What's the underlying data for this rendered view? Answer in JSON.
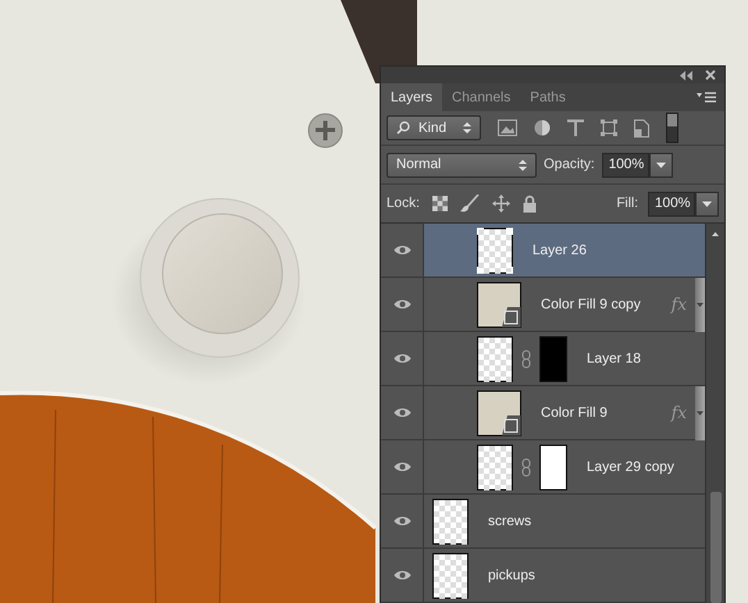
{
  "panel": {
    "tabs": [
      {
        "label": "Layers",
        "selected": true
      },
      {
        "label": "Channels",
        "selected": false
      },
      {
        "label": "Paths",
        "selected": false
      }
    ],
    "filter": {
      "value": "Kind"
    },
    "blend_mode": {
      "value": "Normal"
    },
    "opacity": {
      "label": "Opacity:",
      "value": "100%"
    },
    "lock": {
      "label": "Lock:"
    },
    "fill": {
      "label": "Fill:",
      "value": "100%"
    },
    "layers": [
      {
        "children": [
          {
            "name": "Layer 26",
            "kind": "plain",
            "visible": true,
            "selected": true
          },
          {
            "name": "Color Fill 9 copy",
            "kind": "fill",
            "visible": true,
            "selected": false,
            "effects": "fx"
          },
          {
            "name": "Layer 18",
            "kind": "masked",
            "visible": true,
            "selected": false,
            "color": "#000000"
          },
          {
            "name": "Color Fill 9",
            "kind": "fill",
            "visible": true,
            "selected": false,
            "effects": "fx"
          },
          {
            "name": "Layer 29 copy",
            "kind": "masked",
            "visible": true,
            "selected": false,
            "color": "#ffffff"
          }
        ]
      },
      {
        "name": "screws",
        "kind": "plain",
        "visible": true,
        "selected": false
      },
      {
        "name": "pickups",
        "kind": "plain",
        "visible": true,
        "selected": false
      }
    ]
  }
}
